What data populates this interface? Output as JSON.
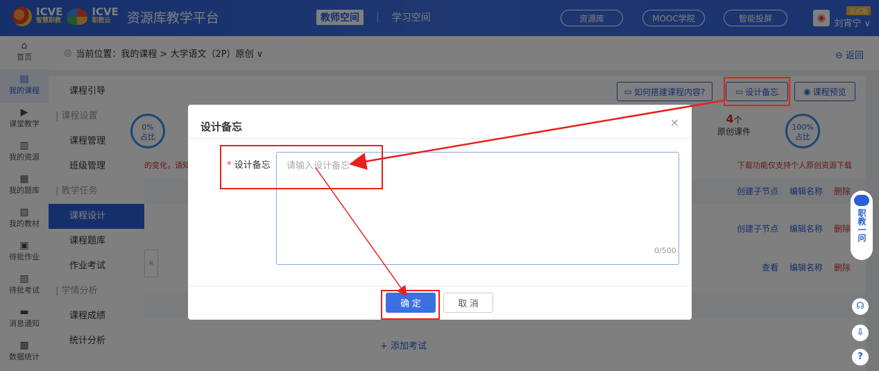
{
  "header": {
    "brand1": "ICVE",
    "brand1_sub": "智慧职教",
    "brand2": "ICVE",
    "brand2_sub": "职教云",
    "platform_title": "资源库教学平台",
    "nav_teacher": "教师空间",
    "nav_separator": "|",
    "nav_student": "学习空间",
    "pill_resource": "资源库",
    "pill_mooc": "MOOC学院",
    "pill_screen": "智能投屏",
    "user_badge": "正式版",
    "user_name": "刘宵宁 ∨"
  },
  "sidebar": {
    "items": [
      {
        "icon": "home-icon",
        "glyph": "⌂",
        "label": "首页"
      },
      {
        "icon": "book-icon",
        "glyph": "▤",
        "label": "我的课程"
      },
      {
        "icon": "play-icon",
        "glyph": "▶",
        "label": "课堂教学"
      },
      {
        "icon": "library-icon",
        "glyph": "▥",
        "label": "我的资源"
      },
      {
        "icon": "question-bank-icon",
        "glyph": "▦",
        "label": "我的题库"
      },
      {
        "icon": "textbook-icon",
        "glyph": "▧",
        "label": "我的教材"
      },
      {
        "icon": "homework-icon",
        "glyph": "▣",
        "label": "待批作业"
      },
      {
        "icon": "exam-icon",
        "glyph": "▨",
        "label": "待批考试"
      },
      {
        "icon": "message-icon",
        "glyph": "▬",
        "label": "消息通知"
      },
      {
        "icon": "stats-icon",
        "glyph": "▩",
        "label": "数据统计"
      }
    ]
  },
  "breadcrumb": {
    "text": "当前位置：我的课程 > 大学语文（2P）原创 ∨",
    "back": "返回"
  },
  "submenu": {
    "intro": "课程引导",
    "group_settings": "课程设置",
    "manage": "课程管理",
    "class_manage": "班级管理",
    "group_tasks": "教学任务",
    "design": "课程设计",
    "question_bank": "课程题库",
    "homework": "作业考试",
    "group_analysis": "学情分析",
    "grades": "课程成绩",
    "stats": "统计分析"
  },
  "main": {
    "how_to_btn": "如何搭建课程内容?",
    "design_note_btn": "设计备忘",
    "preview_btn": "课程预览",
    "ring_left_top": "0%",
    "ring_left_bottom": "占比",
    "original_count": "4",
    "original_unit": "个",
    "original_label": "原创课件",
    "ring_right_top": "100%",
    "ring_right_bottom": "占比",
    "left_note": "的变化，请知",
    "right_note": "下载功能仅支持个人原创资源下载",
    "row_actions": {
      "create_child": "创建子节点",
      "edit_name": "编辑名称",
      "delete": "删除",
      "view": "查看"
    },
    "add_exam": "+ 添加考试",
    "collapse": "«"
  },
  "bot": {
    "text": "职教一问"
  },
  "dialog": {
    "title": "设计备忘",
    "close": "×",
    "field_required": "*",
    "field_label": "设计备忘",
    "placeholder": "请输入设计备忘",
    "counter": "0/500",
    "confirm": "确 定",
    "cancel": "取 消"
  },
  "colors": {
    "brand": "#2a5fd6",
    "highlight": "#e8201a",
    "danger": "#d03030"
  }
}
